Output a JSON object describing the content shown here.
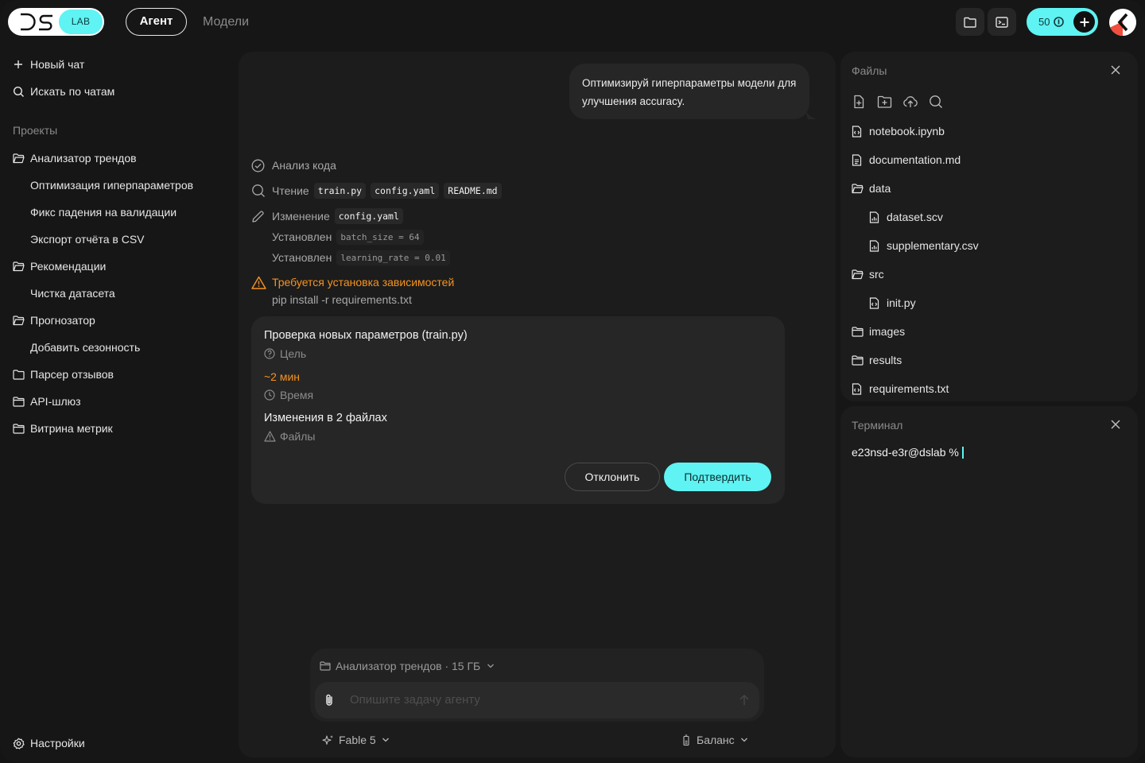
{
  "brand": {
    "logo_text": "DS",
    "badge": "LAB"
  },
  "topnav": {
    "agent": "Агент",
    "models": "Модели"
  },
  "toolbar": {
    "credits": "50"
  },
  "sidebar": {
    "new_chat": "Новый чат",
    "search": "Искать по чатам",
    "projects_heading": "Проекты",
    "items": [
      {
        "label": "Анализатор трендов"
      },
      {
        "label": "Оптимизация гиперпараметров"
      },
      {
        "label": "Фикс падения на валидации"
      },
      {
        "label": "Экспорт отчёта в CSV"
      },
      {
        "label": "Рекомендации"
      },
      {
        "label": "Чистка датасета"
      },
      {
        "label": "Прогнозатор"
      },
      {
        "label": "Добавить сезонность"
      },
      {
        "label": "Парсер отзывов"
      },
      {
        "label": "API-шлюз"
      },
      {
        "label": "Витрина метрик"
      }
    ],
    "settings": "Настройки"
  },
  "chat": {
    "user_message": "Оптимизируй гиперпараметры модели для улучшения accuracy.",
    "steps": {
      "analysis": "Анализ кода",
      "reading_label": "Чтение",
      "reading_files": [
        "train.py",
        "config.yaml",
        "README.md"
      ],
      "editing_label": "Изменение",
      "editing_file": "config.yaml",
      "set_label": "Установлен",
      "set_values": [
        "batch_size = 64",
        "learning_rate = 0.01"
      ],
      "warning": "Требуется установка зависимостей",
      "command": "pip install -r requirements.txt"
    },
    "card": {
      "title": "Проверка новых параметров (train.py)",
      "goal_label": "Цель",
      "time_value": "~2 мин",
      "time_label": "Время",
      "files_value": "Изменения в 2 файлах",
      "files_label": "Файлы",
      "reject": "Отклонить",
      "confirm": "Подтвердить"
    },
    "composer": {
      "context": "Анализатор трендов · 15 ГБ",
      "placeholder": "Опишите задачу агенту",
      "model": "Fable 5",
      "balance": "Баланс"
    }
  },
  "files_panel": {
    "title": "Файлы",
    "items": [
      {
        "name": "notebook.ipynb",
        "type": "file"
      },
      {
        "name": "documentation.md",
        "type": "file"
      },
      {
        "name": "data",
        "type": "folder"
      },
      {
        "name": "dataset.scv",
        "type": "file"
      },
      {
        "name": "supplementary.csv",
        "type": "file"
      },
      {
        "name": "src",
        "type": "folder"
      },
      {
        "name": "init.py",
        "type": "file"
      },
      {
        "name": "images",
        "type": "folder"
      },
      {
        "name": "results",
        "type": "folder"
      },
      {
        "name": "requirements.txt",
        "type": "file"
      }
    ]
  },
  "terminal": {
    "title": "Терминал",
    "prompt": "e23nsd-e3r@dslab %"
  },
  "colors": {
    "accent": "#5FF3F3",
    "warning": "#F7931E",
    "background": "#161616",
    "panel": "#1C1C1C"
  }
}
